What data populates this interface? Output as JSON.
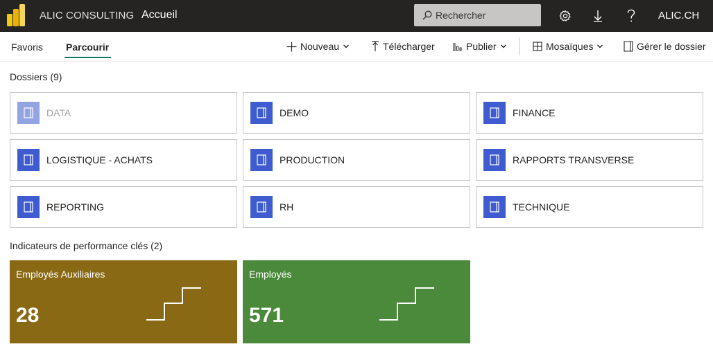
{
  "header": {
    "org_name": "ALIC CONSULTING",
    "page_name": "Accueil",
    "search_placeholder": "Rechercher",
    "tenant": "ALIC.CH",
    "icons": [
      "settings-icon",
      "download-icon",
      "help-icon"
    ]
  },
  "subnav": {
    "tabs": [
      {
        "label": "Favoris",
        "active": false
      },
      {
        "label": "Parcourir",
        "active": true
      }
    ],
    "actions": {
      "new": "Nouveau",
      "upload": "Télécharger",
      "publish": "Publier",
      "tiles": "Mosaïques",
      "manage": "Gérer le dossier"
    }
  },
  "folders": {
    "title": "Dossiers (9)",
    "items": [
      {
        "label": "DATA",
        "dimmed": true
      },
      {
        "label": "DEMO",
        "dimmed": false
      },
      {
        "label": "FINANCE",
        "dimmed": false
      },
      {
        "label": "LOGISTIQUE - ACHATS",
        "dimmed": false
      },
      {
        "label": "PRODUCTION",
        "dimmed": false
      },
      {
        "label": "RAPPORTS TRANSVERSE",
        "dimmed": false
      },
      {
        "label": "REPORTING",
        "dimmed": false
      },
      {
        "label": "RH",
        "dimmed": false
      },
      {
        "label": "TECHNIQUE",
        "dimmed": false
      }
    ]
  },
  "kpis": {
    "title": "Indicateurs de performance clés (2)",
    "items": [
      {
        "title": "Employés Auxiliaires",
        "value": "28",
        "color": "#8a6914"
      },
      {
        "title": "Employés",
        "value": "571",
        "color": "#4b8a3a"
      }
    ]
  },
  "colors": {
    "topbar": "#252423",
    "accent": "#117865",
    "folder_icon": "#3e5bd0"
  }
}
